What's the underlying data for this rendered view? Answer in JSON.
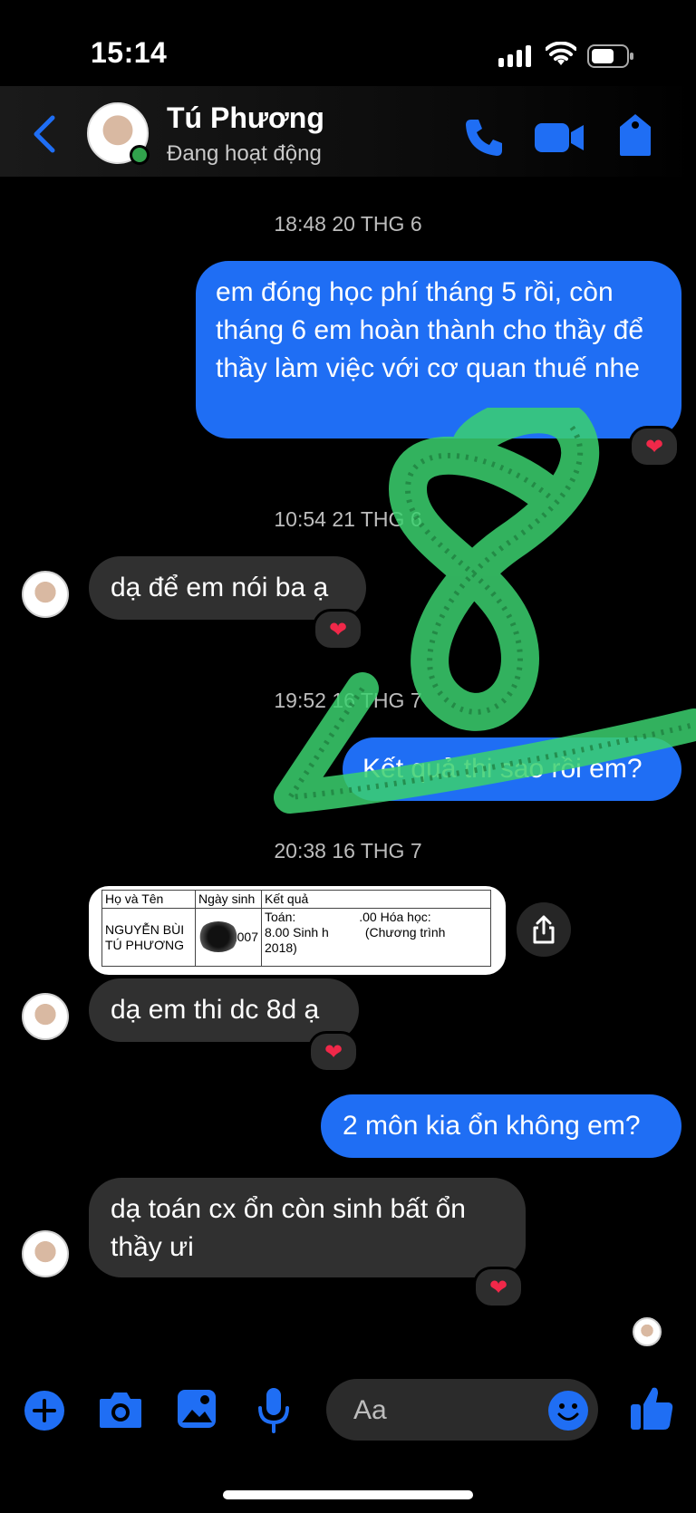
{
  "status_bar": {
    "time": "15:14"
  },
  "header": {
    "contact_name": "Tú Phương",
    "contact_status": "Đang hoạt động",
    "icons": [
      "back-arrow-icon",
      "phone-icon",
      "video-camera-icon",
      "tag-icon"
    ]
  },
  "messages": {
    "ts1": "18:48 20 THG 6",
    "out1": "em đóng học phí tháng 5 rồi, còn tháng 6 em hoàn thành cho thầy để thầy làm việc với cơ quan thuế nhe",
    "ts2": "10:54 21 THG 6",
    "in1": "dạ để em nói ba ạ",
    "ts3": "19:52 16 THG 7",
    "out2": "Kết quả thi sao rồi em?",
    "ts4": "20:38 16 THG 7",
    "in2": "dạ em thi dc 8d ạ",
    "out3": "2 môn kia ổn không em?",
    "in3": "dạ toán cx ổn còn sinh bất ổn thầy ưi",
    "reaction": "❤"
  },
  "result_image": {
    "headers": [
      "Họ và Tên",
      "Ngày sinh",
      "Kết quả"
    ],
    "name": "NGUYỄN BÙI TÚ PHƯƠNG",
    "dob_suffix": "/2007",
    "result_line1": "Toán:",
    "result_line1b": ".00 Hóa học:",
    "result_line2": "8.00 Sinh h",
    "result_line2b": "(Chương trình",
    "result_line3": "2018)"
  },
  "composer": {
    "placeholder": "Aa"
  },
  "colors": {
    "accent": "#1f6ef4",
    "incoming_bubble": "#303030",
    "scribble": "#3bd16f",
    "heart": "#f02849"
  }
}
